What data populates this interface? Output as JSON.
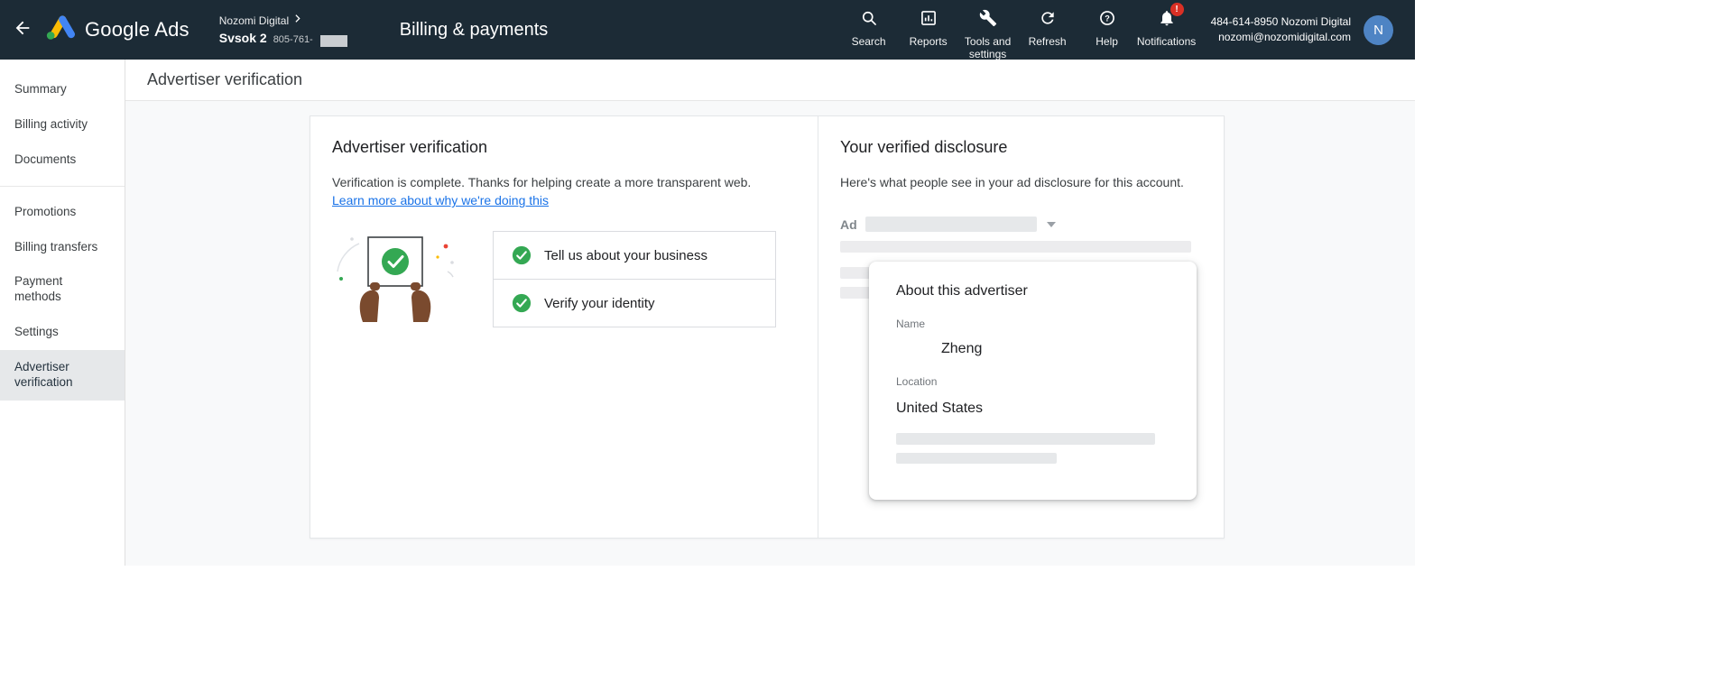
{
  "topbar": {
    "product_name": "Google Ads",
    "account_label": "Nozomi Digital",
    "account_sub_label": "Svsok 2",
    "account_sub_id": "805-761-",
    "section_title": "Billing & payments",
    "nav": [
      {
        "label": "Search"
      },
      {
        "label": "Reports"
      },
      {
        "label": "Tools and settings"
      },
      {
        "label": "Refresh"
      },
      {
        "label": "Help"
      },
      {
        "label": "Notifications"
      }
    ],
    "notification_badge": "!",
    "account_line1": "484-614-8950 Nozomi Digital",
    "account_line2": "nozomi@nozomidigital.com",
    "avatar_initial": "N"
  },
  "sidebar": {
    "items": [
      {
        "label": "Summary"
      },
      {
        "label": "Billing activity"
      },
      {
        "label": "Documents"
      },
      {
        "label": "Promotions"
      },
      {
        "label": "Billing transfers"
      },
      {
        "label": "Payment methods"
      },
      {
        "label": "Settings"
      },
      {
        "label": "Advertiser verification"
      }
    ],
    "selected": "Advertiser verification"
  },
  "page": {
    "title": "Advertiser verification"
  },
  "verification_panel": {
    "heading": "Advertiser verification",
    "message": "Verification is complete. Thanks for helping create a more transparent web.",
    "link_text": "Learn more about why we're doing this",
    "checklist": [
      {
        "label": "Tell us about your business"
      },
      {
        "label": "Verify your identity"
      }
    ]
  },
  "disclosure_panel": {
    "heading": "Your verified disclosure",
    "message": "Here's what people see in your ad disclosure for this account.",
    "ad_label": "Ad",
    "about_card": {
      "title": "About this advertiser",
      "name_label": "Name",
      "name_value": "Zheng",
      "location_label": "Location",
      "location_value": "United States"
    }
  },
  "colors": {
    "topbar_bg": "#1c2b36",
    "accent_blue": "#1a73e8",
    "success_green": "#34a853",
    "badge_red": "#d93025",
    "avatar_blue": "#4e84c4"
  }
}
